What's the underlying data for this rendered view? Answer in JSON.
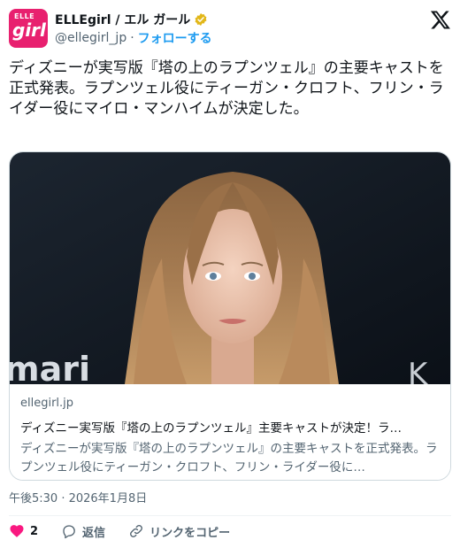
{
  "header": {
    "avatar_text_small": "ELLE",
    "avatar_text_large": "girl",
    "display_name": "ELLEgirl / エル ガール",
    "handle": "@ellegirl_jp",
    "separator": "·",
    "follow_label": "フォローする"
  },
  "tweet": {
    "text": "ディズニーが実写版『塔の上のラプンツェル』の主要キャストを正式発表。ラプンツェル役にティーガン・クロフト、フリン・ライダー役にマイロ・マンハイムが決定した。"
  },
  "card": {
    "image_text": "mari",
    "domain": "ellegirl.jp",
    "title": "ディズニー実写版『塔の上のラプンツェル』主要キャストが決定！ラ…",
    "description": "ディズニーが実写版『塔の上のラプンツェル』の主要キャストを正式発表。ラプンツェル役にティーガン・クロフト、フリン・ライダー役に…"
  },
  "timestamp": "午後5:30 · 2026年1月8日",
  "actions": {
    "like_count": "2",
    "reply_label": "返信",
    "copy_link_label": "リンクをコピー"
  },
  "colors": {
    "brand_pink": "#e8206f",
    "link_blue": "#1d9bf0",
    "like_red": "#f91880",
    "verified_gold": "#e2b719"
  }
}
